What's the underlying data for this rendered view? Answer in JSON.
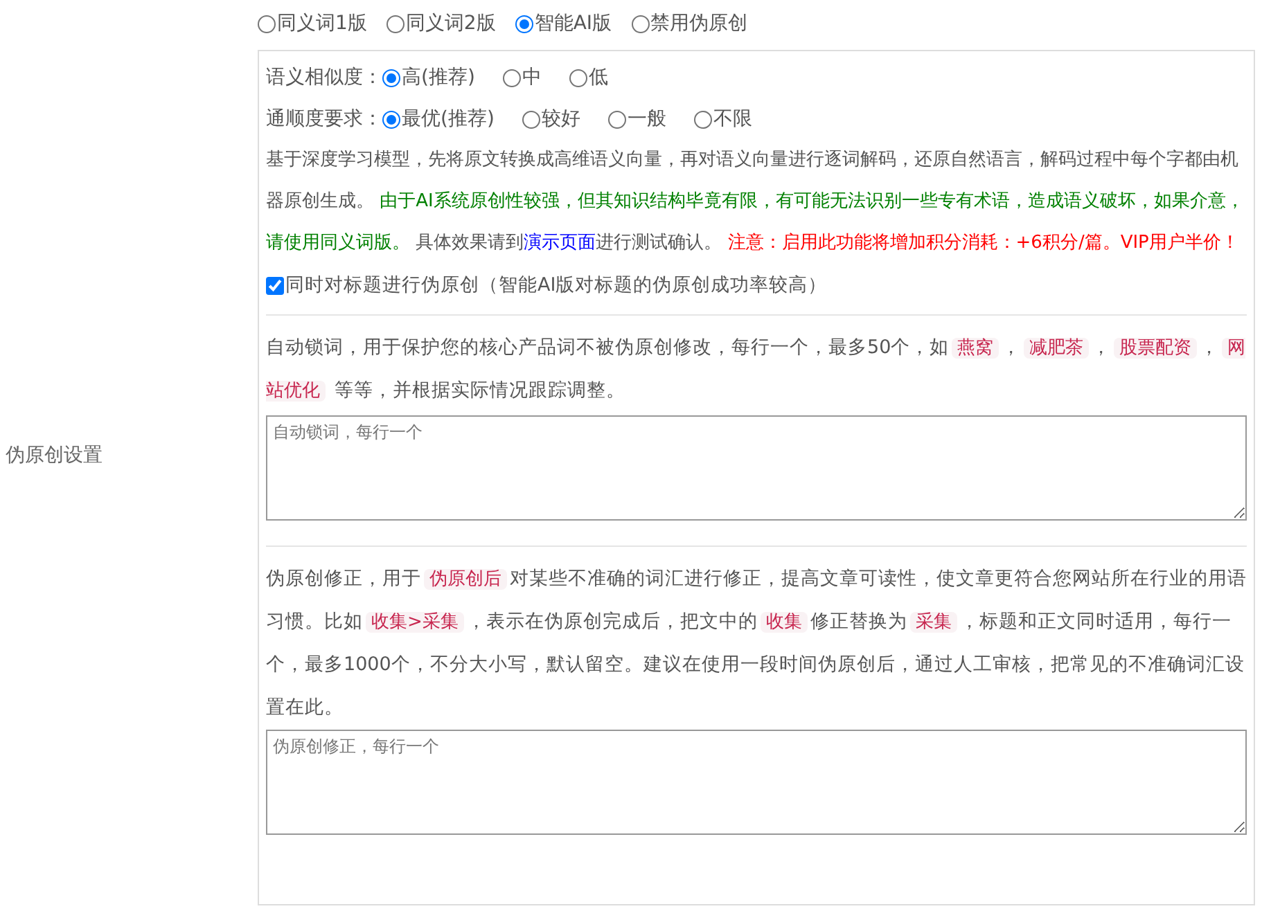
{
  "section_label": "伪原创设置",
  "modes": [
    {
      "label": "同义词1版",
      "selected": false
    },
    {
      "label": "同义词2版",
      "selected": false
    },
    {
      "label": "智能AI版",
      "selected": true
    },
    {
      "label": "禁用伪原创",
      "selected": false
    }
  ],
  "similarity": {
    "label": "语义相似度：",
    "options": [
      {
        "label": "高(推荐)",
        "selected": true
      },
      {
        "label": "中",
        "selected": false
      },
      {
        "label": "低",
        "selected": false
      }
    ]
  },
  "fluency": {
    "label": "通顺度要求：",
    "options": [
      {
        "label": "最优(推荐)",
        "selected": true
      },
      {
        "label": "较好",
        "selected": false
      },
      {
        "label": "一般",
        "selected": false
      },
      {
        "label": "不限",
        "selected": false
      }
    ]
  },
  "description": [
    {
      "kind": "text",
      "text": "基于深度学习模型，先将原文转换成高维语义向量，再对语义向量进行逐词解码，还原自然语言，解码过程中每个字都由机器原创生成。 "
    },
    {
      "kind": "green",
      "text": "由于AI系统原创性较强，但其知识结构毕竟有限，有可能无法识别一些专有术语，造成语义破坏，如果介意，请使用同义词版。"
    },
    {
      "kind": "text",
      "text": " 具体效果请到"
    },
    {
      "kind": "link",
      "text": "演示页面"
    },
    {
      "kind": "text",
      "text": "进行测试确认。 "
    },
    {
      "kind": "red",
      "text": "注意：启用此功能将增加积分消耗：+6积分/篇。VIP用户半价！"
    }
  ],
  "title_option": {
    "label": "同时对标题进行伪原创（智能AI版对标题的伪原创成功率较高）",
    "checked": true
  },
  "lock_words": {
    "description": [
      {
        "kind": "text",
        "text": "自动锁词，用于保护您的核心产品词不被伪原创修改，每行一个，最多50个，如"
      },
      {
        "kind": "code",
        "text": "燕窝"
      },
      {
        "kind": "text",
        "text": "，"
      },
      {
        "kind": "code",
        "text": "减肥茶"
      },
      {
        "kind": "text",
        "text": "，"
      },
      {
        "kind": "code",
        "text": "股票配资"
      },
      {
        "kind": "text",
        "text": "，"
      },
      {
        "kind": "code",
        "text": "网站优化"
      },
      {
        "kind": "text",
        "text": " 等等，并根据实际情况跟踪调整。"
      }
    ],
    "placeholder": "自动锁词，每行一个"
  },
  "correction": {
    "description": [
      {
        "kind": "text",
        "text": "伪原创修正，用于"
      },
      {
        "kind": "code",
        "text": "伪原创后"
      },
      {
        "kind": "text",
        "text": "对某些不准确的词汇进行修正，提高文章可读性，使文章更符合您网站所在行业的用语习惯。比如"
      },
      {
        "kind": "code",
        "text": "收集>采集"
      },
      {
        "kind": "text",
        "text": "，表示在伪原创完成后，把文中的"
      },
      {
        "kind": "code",
        "text": "收集"
      },
      {
        "kind": "text",
        "text": "修正替换为"
      },
      {
        "kind": "code",
        "text": "采集"
      },
      {
        "kind": "text",
        "text": "，标题和正文同时适用，每行一个，最多1000个，不分大小写，默认留空。建议在使用一段时间伪原创后，通过人工审核，把常见的不准确词汇设置在此。"
      }
    ],
    "placeholder": "伪原创修正，每行一个"
  }
}
